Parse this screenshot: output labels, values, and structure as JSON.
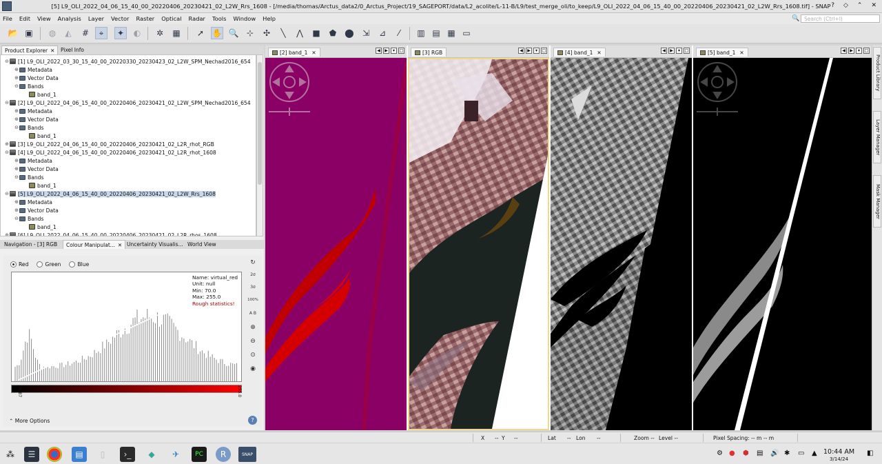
{
  "window": {
    "title": "[5] L9_OLI_2022_04_06_15_40_00_20220406_20230421_02_L2W_Rrs_1608 - [/media/thomas/Arctus_data2/0_Arctus_Project/19_SAGEPORT/data/L2_acolite/L-11-B/L9/test_merge_oli/to_keep/L9_OLI_2022_04_06_15_40_00_20220406_20230421_02_L2W_Rrs_1608.tif] - SNAP",
    "controls": [
      "?",
      "◇",
      "⌃",
      "✕"
    ]
  },
  "menu": [
    "File",
    "Edit",
    "View",
    "Analysis",
    "Layer",
    "Vector",
    "Raster",
    "Optical",
    "Radar",
    "Tools",
    "Window",
    "Help"
  ],
  "search": {
    "placeholder": "Search (Ctrl+I)"
  },
  "explorer": {
    "tabs": [
      {
        "label": "Product Explorer",
        "close": "✕"
      },
      {
        "label": "Pixel Info"
      }
    ],
    "tree": [
      {
        "depth": 0,
        "exp": "⊖",
        "icon": "prod",
        "label": "[1] L9_OLI_2022_03_30_15_40_00_20220330_20230423_02_L2W_SPM_Nechad2016_654"
      },
      {
        "depth": 1,
        "exp": "⊕",
        "icon": "fold",
        "label": "Metadata"
      },
      {
        "depth": 1,
        "exp": "⊕",
        "icon": "fold",
        "label": "Vector Data"
      },
      {
        "depth": 1,
        "exp": "⊖",
        "icon": "fold",
        "label": "Bands"
      },
      {
        "depth": 2,
        "exp": "",
        "icon": "band",
        "label": "band_1"
      },
      {
        "depth": 0,
        "exp": "⊖",
        "icon": "prod",
        "label": "[2] L9_OLI_2022_04_06_15_40_00_20220406_20230421_02_L2W_SPM_Nechad2016_654"
      },
      {
        "depth": 1,
        "exp": "⊕",
        "icon": "fold",
        "label": "Metadata"
      },
      {
        "depth": 1,
        "exp": "⊕",
        "icon": "fold",
        "label": "Vector Data"
      },
      {
        "depth": 1,
        "exp": "⊖",
        "icon": "fold",
        "label": "Bands"
      },
      {
        "depth": 2,
        "exp": "",
        "icon": "band",
        "label": "band_1"
      },
      {
        "depth": 0,
        "exp": "⊕",
        "icon": "prod",
        "label": "[3] L9_OLI_2022_04_06_15_40_00_20220406_20230421_02_L2R_rhot_RGB"
      },
      {
        "depth": 0,
        "exp": "⊖",
        "icon": "prod",
        "label": "[4] L9_OLI_2022_04_06_15_40_00_20220406_20230421_02_L2R_rhot_1608"
      },
      {
        "depth": 1,
        "exp": "⊕",
        "icon": "fold",
        "label": "Metadata"
      },
      {
        "depth": 1,
        "exp": "⊕",
        "icon": "fold",
        "label": "Vector Data"
      },
      {
        "depth": 1,
        "exp": "⊖",
        "icon": "fold",
        "label": "Bands"
      },
      {
        "depth": 2,
        "exp": "",
        "icon": "band",
        "label": "band_1"
      },
      {
        "depth": 0,
        "exp": "⊖",
        "icon": "prod",
        "label": "[5] L9_OLI_2022_04_06_15_40_00_20220406_20230421_02_L2W_Rrs_1608",
        "selected": true
      },
      {
        "depth": 1,
        "exp": "⊕",
        "icon": "fold",
        "label": "Metadata"
      },
      {
        "depth": 1,
        "exp": "⊕",
        "icon": "fold",
        "label": "Vector Data"
      },
      {
        "depth": 1,
        "exp": "⊖",
        "icon": "fold",
        "label": "Bands"
      },
      {
        "depth": 2,
        "exp": "",
        "icon": "band",
        "label": "band_1"
      },
      {
        "depth": 0,
        "exp": "⊕",
        "icon": "prod",
        "label": "[6] L9_OLI_2022_04_06_15_40_00_20220406_20230421_02_L2R_rhos_1608"
      }
    ]
  },
  "lowertabs": [
    {
      "label": "Navigation - [3] RGB"
    },
    {
      "label": "Colour Manipulat...",
      "close": "✕"
    },
    {
      "label": "Uncertainty Visualis..."
    },
    {
      "label": "World View"
    }
  ],
  "colour": {
    "radios": [
      {
        "label": "Red",
        "checked": true
      },
      {
        "label": "Green"
      },
      {
        "label": "Blue"
      }
    ],
    "info": {
      "name": "Name: virtual_red",
      "unit": "Unit: null",
      "min": "Min: 70.0",
      "max": "Max: 255.0",
      "warn": "Rough statistics!"
    },
    "slider_min": "76.87",
    "slider_max": "255.0",
    "tools": [
      "↻",
      "2σ",
      "3σ",
      "100%",
      "A B",
      "⊕",
      "⊖",
      "⊙",
      "◉"
    ],
    "more": "More Options",
    "help": "?"
  },
  "views": [
    {
      "tab": "[2] band_1"
    },
    {
      "tab": "[3] RGB"
    },
    {
      "tab": "[4] band_1"
    },
    {
      "tab": "[5] band_1"
    }
  ],
  "view_nav": [
    "◀",
    "▶",
    "▾",
    "□"
  ],
  "side_tabs": [
    "Product Library",
    "Layer Manager",
    "Mask Manager"
  ],
  "status": {
    "x": "X",
    "x_val": "--",
    "y": "Y",
    "y_val": "--",
    "lat": "Lat",
    "lat_val": "--",
    "lon": "Lon",
    "lon_val": "--",
    "zoom": "Zoom --",
    "level": "Level --",
    "spacing": "Pixel Spacing: -- m -- m"
  },
  "clock": {
    "time": "10:44 AM",
    "date": "3/14/24"
  },
  "colors": {
    "accent": "#c9d8ec",
    "magenta": "#8b0064",
    "red": "#cc0000"
  }
}
